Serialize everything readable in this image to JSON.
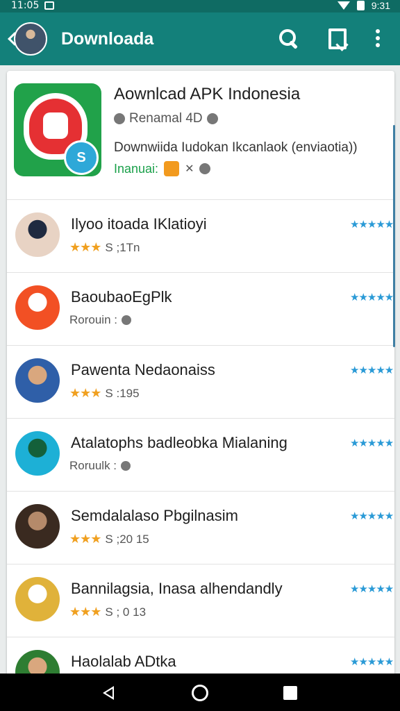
{
  "status_bar": {
    "time": "11:05",
    "right_text": "9:31"
  },
  "app_bar": {
    "title": "Downloada"
  },
  "featured": {
    "title": "Aownlcad APK Indonesia",
    "developer": "Renamal 4D",
    "description": "Downwiida Iudokan Ikcanlaok (enviaotia))",
    "tag_label": "Inanuai:"
  },
  "items": [
    {
      "name": "Ilyoo itoada IKlatioyi",
      "has_stars": true,
      "sub_text": "S ;1Tn",
      "rating": "★★★★★",
      "avatar_colors": [
        "#e8d3c4",
        "#1f2a40"
      ]
    },
    {
      "name": "BaoubaoEgPlk",
      "has_stars": false,
      "sub_text": "Rorouin :",
      "rating": "★★★★★",
      "avatar_colors": [
        "#f25024",
        "#ffffff"
      ]
    },
    {
      "name": "Pawenta Nedaonaiss",
      "has_stars": true,
      "sub_text": "S :195",
      "rating": "★★★★★",
      "avatar_colors": [
        "#2f5fa8",
        "#d9a77e"
      ]
    },
    {
      "name": "Atalatophs badleobka Mialaning",
      "has_stars": false,
      "sub_text": "Roruulk :",
      "rating": "★★★★★",
      "avatar_colors": [
        "#1db0d6",
        "#14603a"
      ]
    },
    {
      "name": "Semdalalaso Pbgilnasim",
      "has_stars": true,
      "sub_text": "S ;20 15",
      "rating": "★★★★★",
      "avatar_colors": [
        "#3a2a20",
        "#b58a6a"
      ]
    },
    {
      "name": "Bannilagsia, Inasa alhendandly",
      "has_stars": true,
      "sub_text": "S ; 0 13",
      "rating": "★★★★★",
      "avatar_colors": [
        "#e0b23a",
        "#ffffff"
      ]
    },
    {
      "name": "Haolalab ADtka",
      "has_stars": false,
      "sub_text": "",
      "rating": "★★★★★",
      "avatar_colors": [
        "#2e7d32",
        "#d9a77e"
      ]
    }
  ],
  "colors": {
    "app_bar": "#13807a",
    "status_bar": "#0f6b63",
    "accent_green": "#1aa04a",
    "star_orange": "#f0a020",
    "rating_blue": "#2a9ad6"
  }
}
